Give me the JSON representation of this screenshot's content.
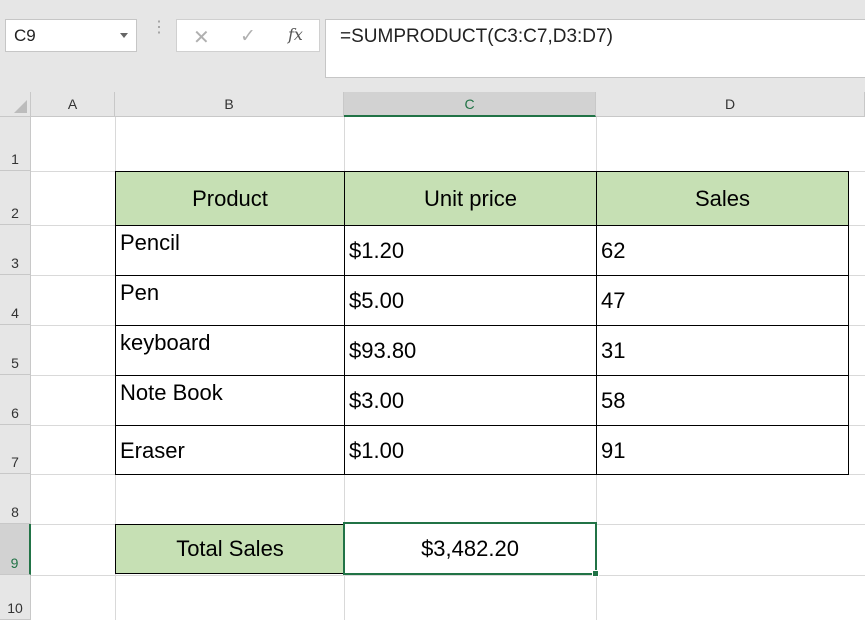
{
  "name_box": {
    "value": "C9"
  },
  "formula_bar": {
    "cancel_icon": "cancel-icon",
    "enter_icon": "enter-icon",
    "fx_label": "fx",
    "formula": "=SUMPRODUCT(C3:C7,D3:D7)"
  },
  "columns": [
    "A",
    "B",
    "C",
    "D"
  ],
  "rows": [
    "1",
    "2",
    "3",
    "4",
    "5",
    "6",
    "7",
    "8",
    "9",
    "10"
  ],
  "selected_cell": "C9",
  "table": {
    "headers": [
      "Product",
      "Unit price",
      "Sales"
    ],
    "rows": [
      [
        "Pencil",
        "$1.20",
        "62"
      ],
      [
        "Pen",
        "$5.00",
        "47"
      ],
      [
        "keyboard",
        "$93.80",
        "31"
      ],
      [
        "Note Book",
        "$3.00",
        "58"
      ],
      [
        "Eraser",
        "$1.00",
        "91"
      ]
    ]
  },
  "total": {
    "label": "Total Sales",
    "value": "$3,482.20"
  },
  "colors": {
    "header_fill": "#c6e0b4",
    "selection": "#217346"
  }
}
